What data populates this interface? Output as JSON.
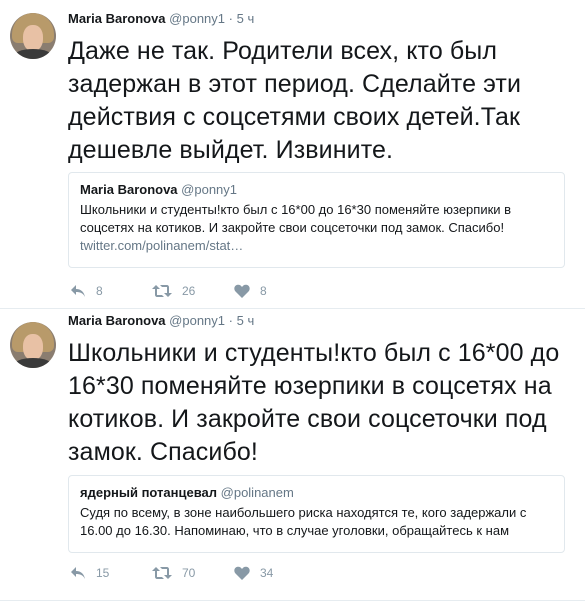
{
  "tweets": [
    {
      "name": "Maria Baronova",
      "handle": "@ponny1",
      "dot": "·",
      "time": "5 ч",
      "text": "Даже не так. Родители всех, кто был задержан в этот период. Сделайте эти действия с соцсетями своих детей.Так дешевле выйдет. Извините.",
      "quote": {
        "name": "Maria Baronova",
        "handle": "@ponny1",
        "text": "Школьники и студенты!кто был с 16*00 до 16*30 поменяйте юзерпики в соцсетях на котиков. И закройте свои соцсеточки под замок. Спасибо!",
        "link": "twitter.com/polinanem/stat…"
      },
      "replies": "8",
      "retweets": "26",
      "likes": "8"
    },
    {
      "name": "Maria Baronova",
      "handle": "@ponny1",
      "dot": "·",
      "time": "5 ч",
      "text": "Школьники и студенты!кто был с 16*00 до 16*30 поменяйте юзерпики в соцсетях на котиков. И закройте свои соцсеточки под замок. Спасибо!",
      "quote": {
        "name": "ядерный потанцевал",
        "handle": "@polinanem",
        "text": "Судя по всему, в зоне наибольшего риска находятся те, кого задержали с 16.00 до 16.30. Напоминаю, что в случае уголовки, обращайтесь к нам"
      },
      "replies": "15",
      "retweets": "70",
      "likes": "34"
    }
  ],
  "colors": {
    "text": "#14171a",
    "secondary": "#657786",
    "action": "#8899a6",
    "border": "#e1e8ed"
  },
  "icons": [
    "reply-icon",
    "retweet-icon",
    "like-icon"
  ]
}
